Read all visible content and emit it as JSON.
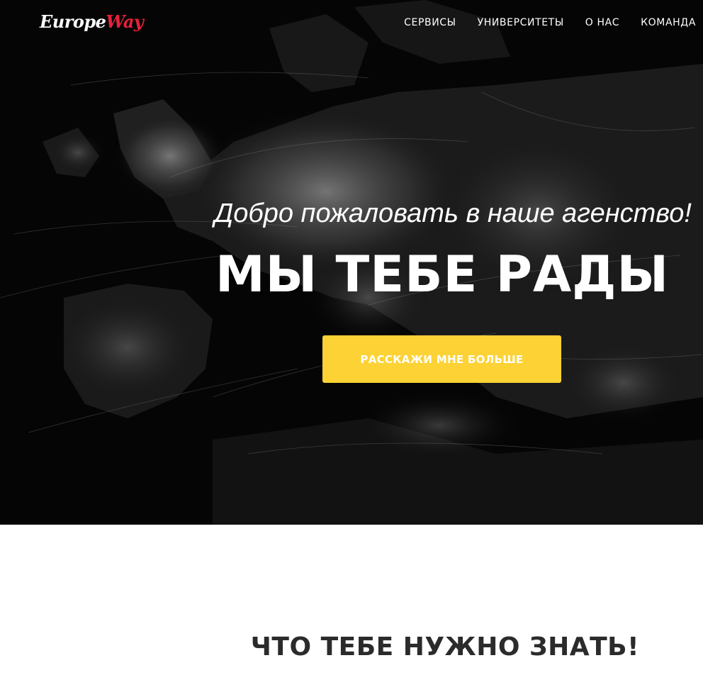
{
  "brand": {
    "logo_part_a": "Europe",
    "logo_part_b": "Way",
    "accent_color": "#e8203a"
  },
  "nav": {
    "items": [
      {
        "label": "СЕРВИСЫ"
      },
      {
        "label": "УНИВЕРСИТЕТЫ"
      },
      {
        "label": "О НАС"
      },
      {
        "label": "КОМАНДА"
      }
    ]
  },
  "hero": {
    "background": "night-map-of-europe",
    "welcome": "Добро пожаловать в наше агенство!",
    "headline": "МЫ ТЕБЕ РАДЫ",
    "cta_label": "РАССКАЖИ МНЕ БОЛЬШЕ",
    "cta_color": "#fcd235"
  },
  "section": {
    "title": "ЧТО ТЕБЕ НУЖНО ЗНАТЬ!"
  }
}
